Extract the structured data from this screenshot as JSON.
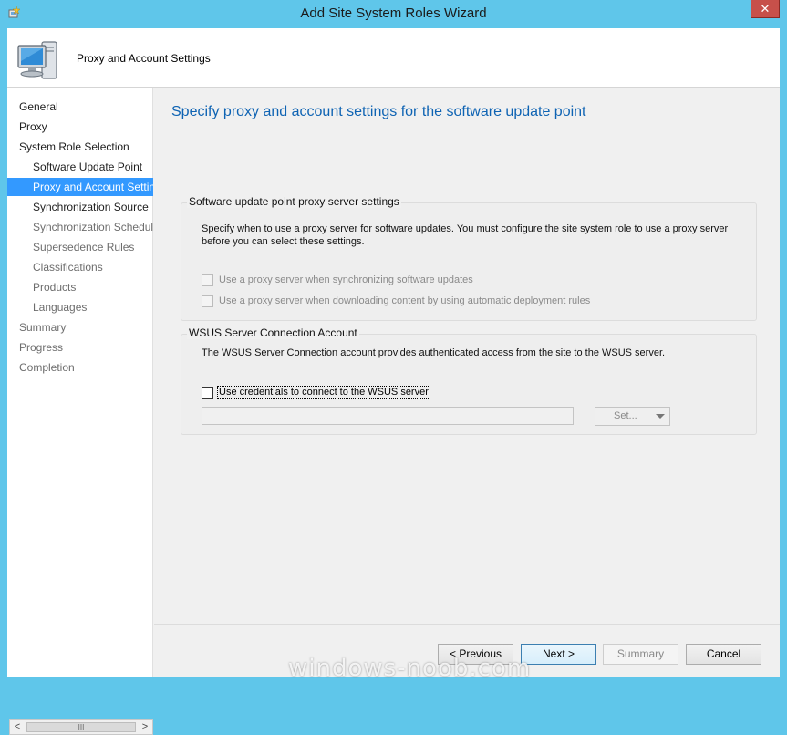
{
  "window": {
    "title": "Add Site System Roles Wizard",
    "close_glyph": "✕",
    "accent_color": "#5fc6ea",
    "close_color": "#c7504a"
  },
  "header": {
    "title": "Proxy and Account Settings",
    "icon": "computer-monitor-icon"
  },
  "nav": {
    "items": [
      {
        "label": "General",
        "state": "done"
      },
      {
        "label": "Proxy",
        "state": "done"
      },
      {
        "label": "System Role Selection",
        "state": "done"
      },
      {
        "label": "Software Update Point",
        "state": "done"
      },
      {
        "label": "Proxy and Account Settings",
        "state": "selected"
      },
      {
        "label": "Synchronization Source",
        "state": "current"
      },
      {
        "label": "Synchronization Schedule",
        "state": "pending"
      },
      {
        "label": "Supersedence Rules",
        "state": "pending"
      },
      {
        "label": "Classifications",
        "state": "pending"
      },
      {
        "label": "Products",
        "state": "pending"
      },
      {
        "label": "Languages",
        "state": "pending"
      },
      {
        "label": "Summary",
        "state": "pending"
      },
      {
        "label": "Progress",
        "state": "pending"
      },
      {
        "label": "Completion",
        "state": "pending"
      }
    ],
    "scroll": {
      "left": "<",
      "thumb": "III",
      "right": ">"
    }
  },
  "main": {
    "page_title": "Specify proxy and account settings for the software update point",
    "proxy_group": {
      "title": "Software update point proxy server settings",
      "description": "Specify when to use a proxy server for software updates. You must configure the site system role to use a proxy server before you can select these settings.",
      "options": [
        {
          "label": "Use a proxy server when synchronizing software updates",
          "checked": false,
          "enabled": false
        },
        {
          "label": "Use a proxy server when downloading content by using automatic deployment rules",
          "checked": false,
          "enabled": false
        }
      ]
    },
    "wsus_group": {
      "title": "WSUS Server Connection Account",
      "description": "The WSUS Server Connection account provides authenticated access from the site to the WSUS server.",
      "credentials_label": "Use credentials to connect to the WSUS server",
      "credentials_checked": false,
      "account_value": "",
      "set_button": "Set..."
    }
  },
  "footer": {
    "previous": "< Previous",
    "next": "Next >",
    "summary": "Summary",
    "cancel": "Cancel"
  },
  "watermark": "windows-noob.com"
}
